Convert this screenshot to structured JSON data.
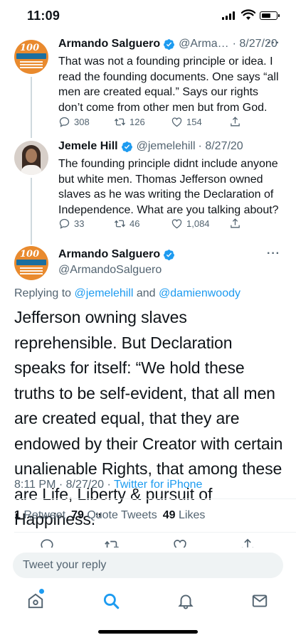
{
  "status_bar": {
    "time": "11:09"
  },
  "thread": [
    {
      "name": "Armando Salguero",
      "handle": "@Arma…",
      "date": "· 8/27/20",
      "avatar": "dolphins-100-avatar",
      "avatar_text": "100",
      "text": "That was not a founding principle or idea. I read the founding documents. One says “all men are created equal.” Says our rights don’t come from other men but from God.",
      "replies": "308",
      "retweets": "126",
      "likes": "154"
    },
    {
      "name": "Jemele Hill",
      "handle": "@jemelehill",
      "date": "· 8/27/20",
      "avatar": "jemele-hill-avatar",
      "text": "The founding principle didnt include anyone but white men. Thomas Jefferson owned slaves as he was writing the Declaration of Independence. What are you talking about?",
      "replies": "33",
      "retweets": "46",
      "likes": "1,084"
    }
  ],
  "main_tweet": {
    "name": "Armando Salguero",
    "handle": "@ArmandoSalguero",
    "avatar_text": "100",
    "replying_prefix": "Replying to ",
    "mention_1": "@jemelehill",
    "replying_and": " and ",
    "mention_2": "@damienwoody",
    "text": "Jefferson owning slaves reprehensible. But Declaration speaks for itself: “We hold these truths to be self-evident, that all men are created equal, that they are endowed by their Creator with certain unalienable Rights, that among these are Life, Liberty & pursuit of Happiness.”",
    "time": "8:11 PM · 8/27/20 · ",
    "source": "Twitter for iPhone",
    "retweet_count": "1",
    "retweet_label": "Retweet",
    "quote_count": "79",
    "quote_label": "Quote Tweets",
    "like_count": "49",
    "like_label": "Likes"
  },
  "reply_bar": {
    "placeholder": "Tweet your reply"
  },
  "tabbar": {
    "items": [
      "home-icon",
      "search-icon",
      "notifications-icon",
      "messages-icon"
    ]
  },
  "colors": {
    "link": "#1d9bf0",
    "secondary": "#536471",
    "text": "#0f1419"
  }
}
